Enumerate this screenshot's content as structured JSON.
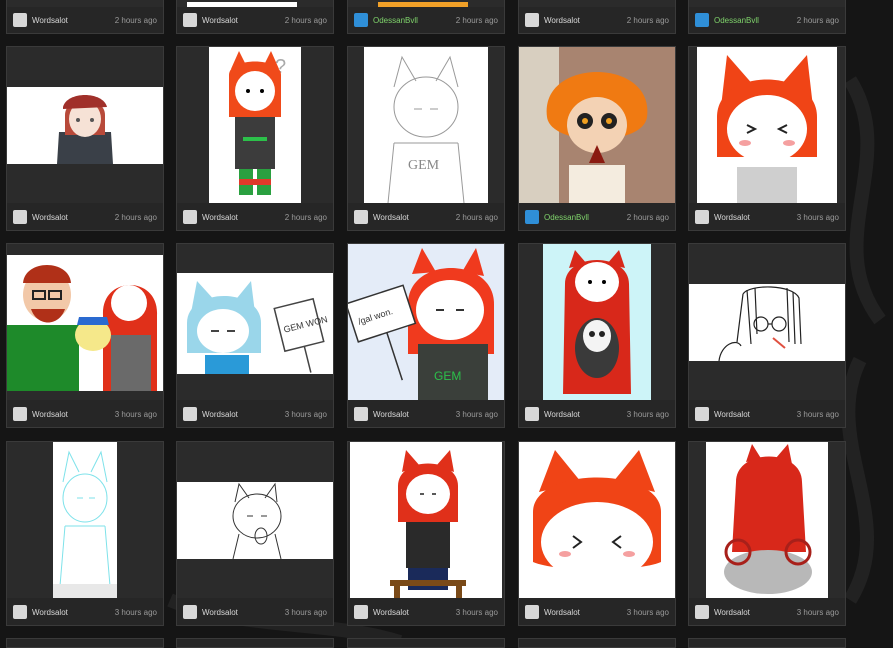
{
  "colors": {
    "background": "#151515",
    "card": "#262626",
    "username_alt": "#7fd36b"
  },
  "rows": [
    {
      "cards": [
        {
          "user": "Wordsalot",
          "time": "2 hours ago",
          "avatar": "wordsalot-avatar",
          "thumb": "partial-drawing"
        },
        {
          "user": "Wordsalot",
          "time": "2 hours ago",
          "avatar": "wordsalot-avatar",
          "thumb": "partial-drawing"
        },
        {
          "user": "OdessanBvll",
          "time": "2 hours ago",
          "avatar": "odessanbvll-avatar",
          "thumb": "partial-drawing"
        },
        {
          "user": "Wordsalot",
          "time": "2 hours ago",
          "avatar": "wordsalot-avatar",
          "thumb": "partial-drawing"
        },
        {
          "user": "OdessanBvll",
          "time": "2 hours ago",
          "avatar": "odessanbvll-avatar",
          "thumb": "partial-drawing"
        }
      ]
    },
    {
      "cards": [
        {
          "user": "Wordsalot",
          "time": "2 hours ago",
          "avatar": "wordsalot-avatar",
          "thumb": "red-hair-soldier-drawing"
        },
        {
          "user": "Wordsalot",
          "time": "2 hours ago",
          "avatar": "wordsalot-avatar",
          "thumb": "fox-girl-confused-drawing"
        },
        {
          "user": "Wordsalot",
          "time": "2 hours ago",
          "avatar": "wordsalot-avatar",
          "thumb": "gem-sweater-sketch"
        },
        {
          "user": "OdessanBvll",
          "time": "2 hours ago",
          "avatar": "odessanbvll-avatar",
          "thumb": "orange-hair-girl-painting"
        },
        {
          "user": "Wordsalot",
          "time": "3 hours ago",
          "avatar": "wordsalot-avatar",
          "thumb": "fox-girl-blush-drawing"
        }
      ]
    },
    {
      "cards": [
        {
          "user": "Wordsalot",
          "time": "3 hours ago",
          "avatar": "wordsalot-avatar",
          "thumb": "group-thumbs-up-drawing"
        },
        {
          "user": "Wordsalot",
          "time": "3 hours ago",
          "avatar": "wordsalot-avatar",
          "thumb": "blue-fox-sign-drawing"
        },
        {
          "user": "Wordsalot",
          "time": "3 hours ago",
          "avatar": "wordsalot-avatar",
          "thumb": "gem-sign-drawing"
        },
        {
          "user": "Wordsalot",
          "time": "3 hours ago",
          "avatar": "wordsalot-avatar",
          "thumb": "hug-skeleton-drawing"
        },
        {
          "user": "Wordsalot",
          "time": "3 hours ago",
          "avatar": "wordsalot-avatar",
          "thumb": "glasses-girl-sketch"
        }
      ]
    },
    {
      "cards": [
        {
          "user": "Wordsalot",
          "time": "3 hours ago",
          "avatar": "wordsalot-avatar",
          "thumb": "cyan-line-sketch"
        },
        {
          "user": "Wordsalot",
          "time": "3 hours ago",
          "avatar": "wordsalot-avatar",
          "thumb": "thinking-fox-sketch"
        },
        {
          "user": "Wordsalot",
          "time": "3 hours ago",
          "avatar": "wordsalot-avatar",
          "thumb": "sitting-fox-drawing"
        },
        {
          "user": "Wordsalot",
          "time": "3 hours ago",
          "avatar": "wordsalot-avatar",
          "thumb": "fox-face-closeup-drawing"
        },
        {
          "user": "Wordsalot",
          "time": "3 hours ago",
          "avatar": "wordsalot-avatar",
          "thumb": "fox-back-drawing"
        }
      ]
    }
  ],
  "labels": {
    "sign_gem_won": "GEM WON",
    "sign_gal_won": "/gal won.",
    "shirt_gem": "GEM",
    "question": "?"
  }
}
